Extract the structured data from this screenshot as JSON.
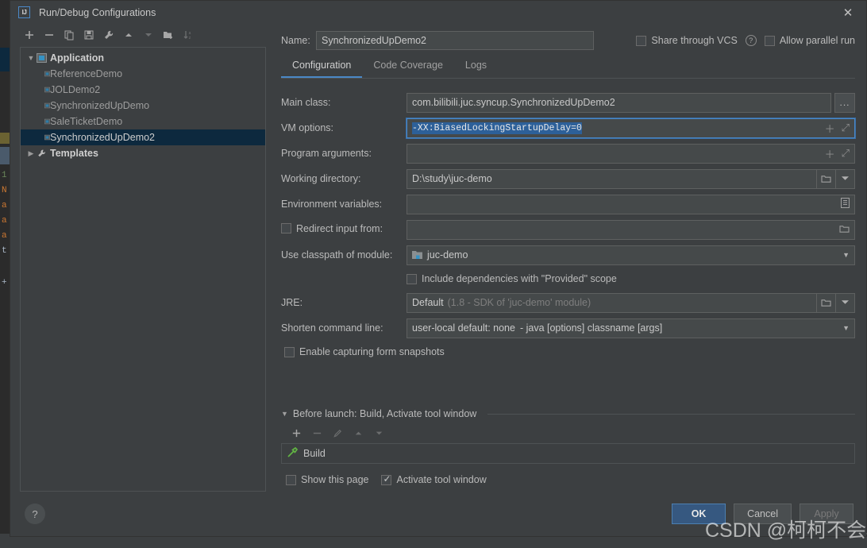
{
  "window": {
    "title": "Run/Debug Configurations",
    "logo_text": "IJ",
    "close_icon": "close-icon"
  },
  "tree_toolbar": [
    {
      "name": "add-configuration-button",
      "icon": "plus-icon",
      "enabled": true
    },
    {
      "name": "remove-configuration-button",
      "icon": "minus-icon",
      "enabled": true
    },
    {
      "name": "copy-configuration-button",
      "icon": "copy-icon",
      "enabled": true
    },
    {
      "name": "save-configuration-button",
      "icon": "save-icon",
      "enabled": true
    },
    {
      "name": "edit-templates-button",
      "icon": "wrench-icon",
      "enabled": true
    },
    {
      "name": "move-up-button",
      "icon": "arrow-up-icon",
      "enabled": true
    },
    {
      "name": "move-down-button",
      "icon": "arrow-down-icon",
      "enabled": false
    },
    {
      "name": "new-folder-button",
      "icon": "new-folder-icon",
      "enabled": true
    },
    {
      "name": "sort-configurations-button",
      "icon": "sort-az-icon",
      "enabled": false
    }
  ],
  "tree": [
    {
      "label": "Application",
      "type": "group",
      "expanded": true,
      "icon": "application-icon",
      "selected": false
    },
    {
      "label": "ReferenceDemo",
      "type": "child",
      "icon": "application-icon",
      "selected": false
    },
    {
      "label": "JOLDemo2",
      "type": "child",
      "icon": "application-icon",
      "selected": false
    },
    {
      "label": "SynchronizedUpDemo",
      "type": "child",
      "icon": "application-icon",
      "selected": false
    },
    {
      "label": "SaleTicketDemo",
      "type": "child",
      "icon": "application-icon",
      "selected": false
    },
    {
      "label": "SynchronizedUpDemo2",
      "type": "child",
      "icon": "application-icon",
      "selected": true
    },
    {
      "label": "Templates",
      "type": "group",
      "expanded": false,
      "icon": "wrench-icon",
      "selected": false
    }
  ],
  "name_row": {
    "label": "Name:",
    "value": "SynchronizedUpDemo2",
    "share_vcs": {
      "label": "Share through VCS",
      "checked": false
    },
    "help_icon": "question-mark-icon",
    "allow_parallel": {
      "label": "Allow parallel run",
      "checked": false
    }
  },
  "tabs": [
    {
      "label": "Configuration",
      "active": true
    },
    {
      "label": "Code Coverage",
      "active": false
    },
    {
      "label": "Logs",
      "active": false
    }
  ],
  "form": {
    "main_class": {
      "label": "Main class:",
      "value": "com.bilibili.juc.syncup.SynchronizedUpDemo2",
      "browse_label": "..."
    },
    "vm_options": {
      "label": "VM options:",
      "value": "-XX:BiasedLockingStartupDelay=0",
      "focused": true,
      "selected": true,
      "expand_icon": "expand-icon",
      "insert_icon": "plus-icon"
    },
    "program_arguments": {
      "label": "Program arguments:",
      "value": "",
      "expand_icon": "expand-icon",
      "insert_icon": "plus-icon"
    },
    "working_directory": {
      "label": "Working directory:",
      "value": "D:\\study\\juc-demo",
      "browse_icon": "folder-icon",
      "dropdown_icon": "chevron-down-icon"
    },
    "environment_variables": {
      "label": "Environment variables:",
      "value": "",
      "browse_icon": "list-icon"
    },
    "redirect_input": {
      "label": "Redirect input from:",
      "checked": false,
      "value": "",
      "browse_icon": "folder-icon"
    },
    "use_classpath_of_module": {
      "label": "Use classpath of module:",
      "value": "juc-demo",
      "icon": "module-icon",
      "dropdown_icon": "chevron-down-icon"
    },
    "include_provided": {
      "label": "Include dependencies with \"Provided\" scope",
      "checked": false
    },
    "jre": {
      "label": "JRE:",
      "value": "Default",
      "hint": "(1.8 - SDK of 'juc-demo' module)",
      "browse_icon": "folder-icon",
      "dropdown_icon": "chevron-down-icon"
    },
    "shorten_command_line": {
      "label": "Shorten command line:",
      "value": "user-local default: none",
      "hint": "- java [options] classname [args]",
      "dropdown_icon": "chevron-down-icon"
    },
    "enable_snapshots": {
      "label": "Enable capturing form snapshots",
      "checked": false
    }
  },
  "before_launch": {
    "title": "Before launch: Build, Activate tool window",
    "expanded": true,
    "toolbar": [
      {
        "name": "add-task-button",
        "icon": "plus-icon",
        "enabled": true
      },
      {
        "name": "remove-task-button",
        "icon": "minus-icon",
        "enabled": false
      },
      {
        "name": "edit-task-button",
        "icon": "pencil-icon",
        "enabled": false
      },
      {
        "name": "task-up-button",
        "icon": "arrow-up-icon",
        "enabled": false
      },
      {
        "name": "task-down-button",
        "icon": "arrow-down-icon",
        "enabled": false
      }
    ],
    "tasks": [
      {
        "label": "Build",
        "icon": "hammer-icon"
      }
    ],
    "show_this_page": {
      "label": "Show this page",
      "checked": false
    },
    "activate_tool_window": {
      "label": "Activate tool window",
      "checked": true
    }
  },
  "footer": {
    "help_icon": "question-mark-icon",
    "ok": {
      "label": "OK",
      "primary": true,
      "enabled": true
    },
    "cancel": {
      "label": "Cancel",
      "primary": false,
      "enabled": true
    },
    "apply": {
      "label": "Apply",
      "primary": false,
      "enabled": false
    }
  },
  "watermark": "CSDN @柯柯不会Java",
  "background_editor": {
    "glyphs": [
      "1",
      "N",
      "a",
      "a",
      "a",
      "t",
      "+"
    ]
  },
  "colors": {
    "accent": "#4a88c7",
    "selection_blue": "#2d6099",
    "tree_selection": "#0d293e",
    "ok_button": "#365880",
    "panel_bg": "#3c3f41",
    "field_bg": "#45494a",
    "build_icon_green": "#62b543"
  }
}
